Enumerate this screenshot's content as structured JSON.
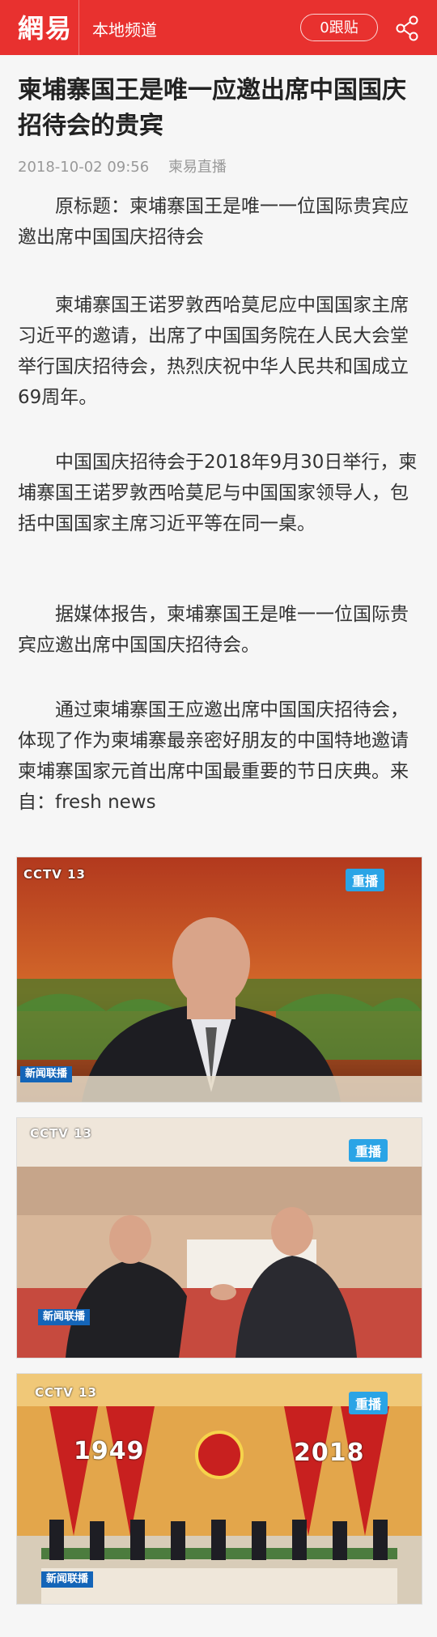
{
  "header": {
    "logo": "網易",
    "channel": "本地频道",
    "follow_label": "0跟贴",
    "share_icon": "share-icon",
    "accent": "#e8312f"
  },
  "article": {
    "title": "柬埔寨国王是唯一应邀出席中国国庆招待会的贵宾",
    "date": "2018-10-02 09:56",
    "source": "柬易直播",
    "paragraphs": [
      "原标题：柬埔寨国王是唯一一位国际贵宾应邀出席中国国庆招待会",
      "柬埔寨国王诺罗敦西哈莫尼应中国国家主席习近平的邀请，出席了中国国务院在人民大会堂举行国庆招待会，热烈庆祝中华人民共和国成立69周年。",
      "中国国庆招待会于2018年9月30日举行，柬埔寨国王诺罗敦西哈莫尼与中国国家领导人，包括中国国家主席习近平等在同一桌。",
      "据媒体报告，柬埔寨国王是唯一一位国际贵宾应邀出席中国国庆招待会。",
      "通过柬埔寨国王应邀出席中国国庆招待会，体现了作为柬埔寨最亲密好朋友的中国特地邀请柬埔寨国家元首出席中国最重要的节日庆典。来自：fresh news"
    ],
    "photos": [
      {
        "channel": "CCTV 13",
        "sub": "新闻",
        "replay": "重播",
        "program": "新闻联播"
      },
      {
        "channel": "CCTV 13",
        "sub": "新闻",
        "replay": "重播",
        "program": "新闻联播"
      },
      {
        "channel": "CCTV 13",
        "sub": "新闻",
        "replay": "重播",
        "program": "新闻联播",
        "left_year": "1949",
        "right_year": "2018"
      }
    ]
  }
}
